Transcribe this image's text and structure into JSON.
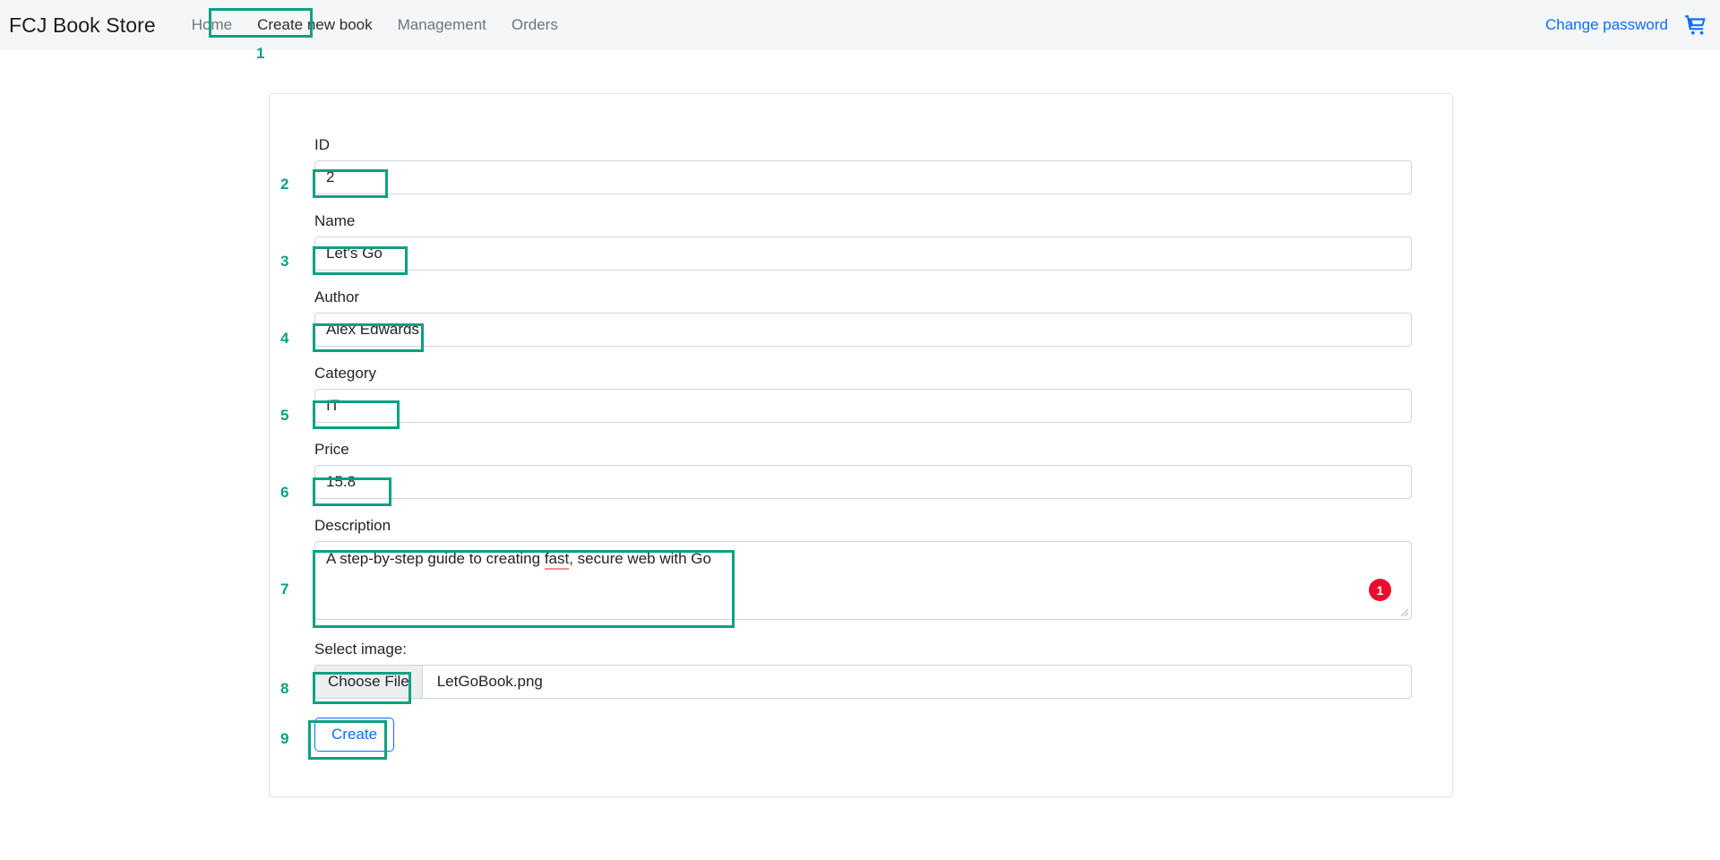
{
  "navbar": {
    "brand": "FCJ Book Store",
    "links": [
      {
        "label": "Home",
        "name": "nav-link-home",
        "active": false
      },
      {
        "label": "Create new book",
        "name": "nav-link-create-new-book",
        "active": true
      },
      {
        "label": "Management",
        "name": "nav-link-management",
        "active": false
      },
      {
        "label": "Orders",
        "name": "nav-link-orders",
        "active": false
      }
    ],
    "change_password": "Change password",
    "cart_icon": "shopping-cart-icon"
  },
  "form": {
    "id": {
      "label": "ID",
      "value": "2"
    },
    "name": {
      "label": "Name",
      "value": "Let's Go"
    },
    "author": {
      "label": "Author",
      "value": "Alex Edwards"
    },
    "category": {
      "label": "Category",
      "value": "IT"
    },
    "price": {
      "label": "Price",
      "value": "15.8"
    },
    "description": {
      "label": "Description",
      "value_pre": "A step-by-step guide to creating ",
      "value_misspelled": "fast",
      "value_post": ", secure web with Go",
      "badge": "1"
    },
    "image": {
      "label": "Select image:",
      "choose_button": "Choose File",
      "file_name": "LetGoBook.png"
    },
    "submit": {
      "label": "Create"
    }
  },
  "annotations": {
    "colors": {
      "box": "#0aa182",
      "badge": "#ee0a2b",
      "link": "#0d6efd"
    },
    "markers": [
      {
        "num": "1"
      },
      {
        "num": "2"
      },
      {
        "num": "3"
      },
      {
        "num": "4"
      },
      {
        "num": "5"
      },
      {
        "num": "6"
      },
      {
        "num": "7"
      },
      {
        "num": "8"
      },
      {
        "num": "9"
      }
    ]
  }
}
